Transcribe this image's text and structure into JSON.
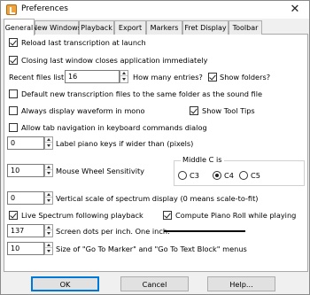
{
  "window": {
    "title": "Preferences",
    "close_glyph": "✕"
  },
  "tabs": [
    {
      "label": "General"
    },
    {
      "label": "New Windows"
    },
    {
      "label": "Playback"
    },
    {
      "label": "Export"
    },
    {
      "label": "Markers"
    },
    {
      "label": "Fret Display"
    },
    {
      "label": "Toolbar"
    }
  ],
  "general": {
    "reload_last": {
      "label": "Reload last transcription at launch",
      "checked": true
    },
    "closing_last": {
      "label": "Closing last window closes application immediately",
      "checked": true
    },
    "recent_files": {
      "label": "Recent files list:",
      "value": "16",
      "how_many": "How many entries?"
    },
    "show_folders": {
      "label": "Show folders?",
      "checked": true
    },
    "default_folder": {
      "label": "Default new transcription files to the same folder as the sound file",
      "checked": false
    },
    "waveform_mono": {
      "label": "Always display waveform in mono",
      "checked": false
    },
    "tool_tips": {
      "label": "Show Tool Tips",
      "checked": true
    },
    "tab_navigation": {
      "label": "Allow tab navigation in keyboard commands dialog",
      "checked": false
    },
    "piano_keys": {
      "value": "0",
      "label": "Label piano keys if wider than (pixels)"
    },
    "wheel_sensitivity": {
      "value": "10",
      "label": "Mouse Wheel Sensitivity"
    },
    "middle_c": {
      "title": "Middle C is",
      "options": [
        "C3",
        "C4",
        "C5"
      ],
      "selected": "C4"
    },
    "vertical_scale": {
      "value": "0",
      "label": "Vertical scale of spectrum display (0 means scale-to-fit)"
    },
    "live_spectrum": {
      "label": "Live Spectrum following playback",
      "checked": true
    },
    "piano_roll": {
      "label": "Compute Piano Roll while playing",
      "checked": true
    },
    "screen_dots": {
      "value": "137",
      "label": "Screen dots per inch. One inch:"
    },
    "goto_size": {
      "value": "10",
      "label": "Size of \"Go To Marker\" and \"Go To Text Block\" menus"
    }
  },
  "buttons": {
    "ok": "OK",
    "cancel": "Cancel",
    "help": "Help..."
  }
}
